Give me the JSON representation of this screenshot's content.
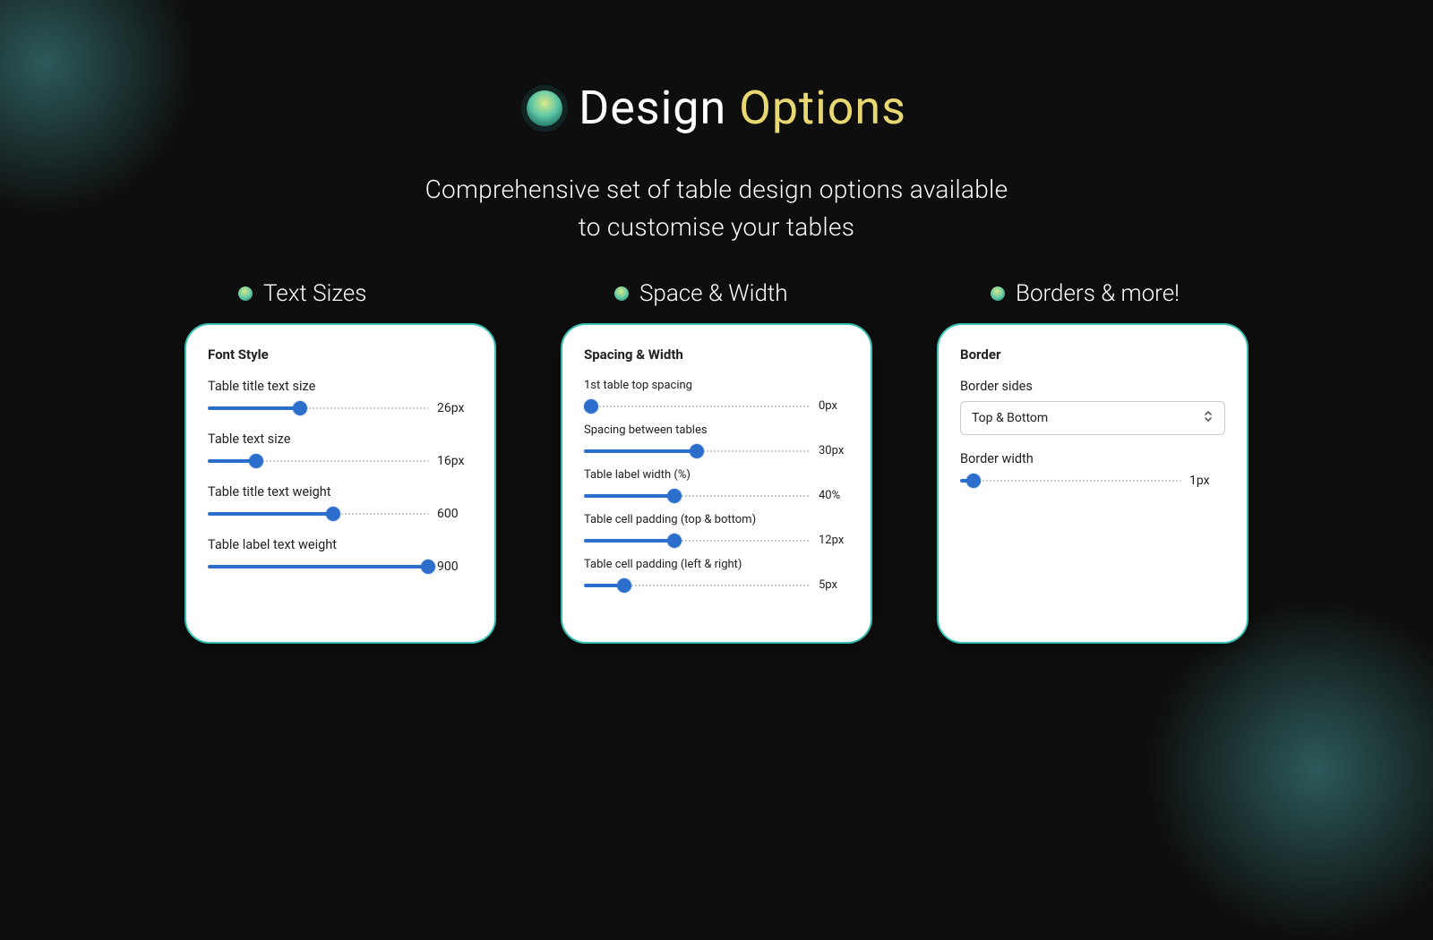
{
  "hero": {
    "title_main": "Design",
    "title_accent": "Options",
    "subtitle_l1": "Comprehensive set of table design options available",
    "subtitle_l2": "to customise your tables"
  },
  "columns": {
    "text_sizes": {
      "header": "Text Sizes",
      "card_heading": "Font Style",
      "settings": [
        {
          "label": "Table title text size",
          "value": "26px",
          "fill_pct": 42
        },
        {
          "label": "Table text size",
          "value": "16px",
          "fill_pct": 22
        },
        {
          "label": "Table title text weight",
          "value": "600",
          "fill_pct": 57
        },
        {
          "label": "Table label text weight",
          "value": "900",
          "fill_pct": 100
        }
      ]
    },
    "space_width": {
      "header": "Space & Width",
      "card_heading": "Spacing & Width",
      "settings": [
        {
          "label": "1st table top spacing",
          "value": "0px",
          "fill_pct": 3
        },
        {
          "label": "Spacing between tables",
          "value": "30px",
          "fill_pct": 50
        },
        {
          "label": "Table label width (%)",
          "value": "40%",
          "fill_pct": 40
        },
        {
          "label": "Table cell padding (top & bottom)",
          "value": "12px",
          "fill_pct": 40
        },
        {
          "label": "Table cell padding (left & right)",
          "value": "5px",
          "fill_pct": 18
        }
      ]
    },
    "borders": {
      "header": "Borders & more!",
      "card_heading": "Border",
      "sides_label": "Border sides",
      "sides_value": "Top & Bottom",
      "width_label": "Border width",
      "width_value": "1px",
      "width_fill_pct": 6
    }
  }
}
